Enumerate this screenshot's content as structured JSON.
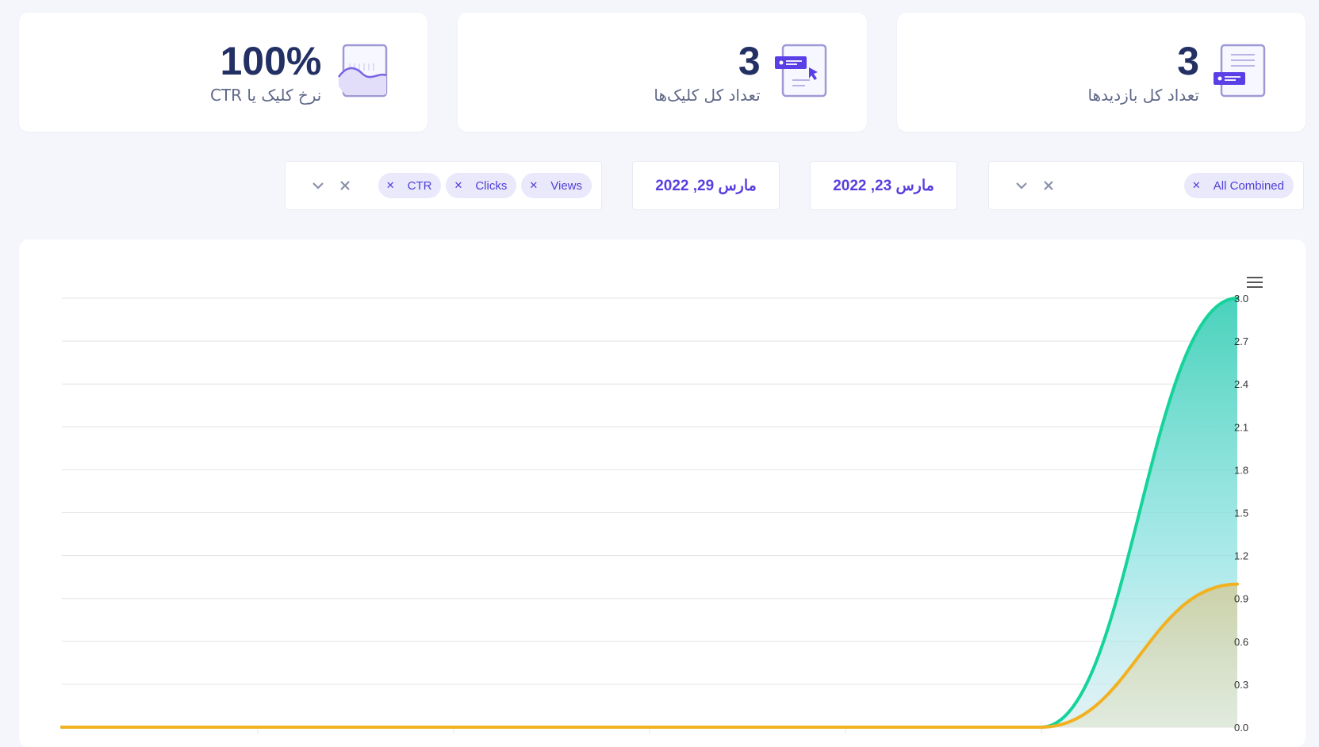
{
  "stats": {
    "views": {
      "value": "3",
      "label": "تعداد کل بازدیدها",
      "icon": "document-view-icon"
    },
    "clicks": {
      "value": "3",
      "label": "تعداد کل کلیک‌ها",
      "icon": "document-click-icon"
    },
    "ctr": {
      "value": "100%",
      "label": "نرخ کلیک یا CTR",
      "icon": "wave-chart-icon"
    }
  },
  "filters": {
    "combined_chip": "All Combined",
    "date_from": "مارس 23, 2022",
    "date_to": "مارس 29, 2022",
    "metric_chips": [
      "Views",
      "Clicks",
      "CTR"
    ]
  },
  "colors": {
    "accent": "#5a3ee0",
    "views_line": "#16d39a",
    "clicks_line": "#f2b120",
    "heading": "#233063"
  },
  "chart_data": {
    "type": "area",
    "ylim": [
      0,
      3.0
    ],
    "y_ticks": [
      "0.0",
      "0.3",
      "0.6",
      "0.9",
      "1.2",
      "1.5",
      "1.8",
      "2.1",
      "2.4",
      "2.7",
      "3.0"
    ],
    "x": [
      1,
      2,
      3,
      4,
      5,
      6,
      7
    ],
    "series": [
      {
        "values": [
          0,
          0,
          0,
          0,
          0,
          0,
          3
        ],
        "color": "#16d39a"
      },
      {
        "values": [
          0,
          0,
          0,
          0,
          0,
          0,
          1
        ],
        "color": "#f2b120"
      }
    ],
    "grid": true
  }
}
